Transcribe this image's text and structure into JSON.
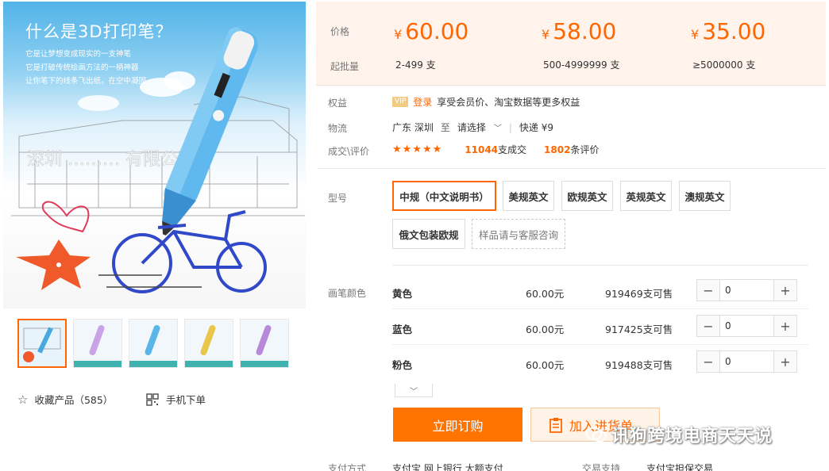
{
  "gallery": {
    "promo_title": "什么是3D打印笔？",
    "promo_lines": [
      "它是让梦想变成现实的一支神笔",
      "它是打破传统绘画方法的一柄神器",
      "让你笔下的线条飞出纸，在空中凝固"
    ],
    "watermark_text": "深圳…………有限公司",
    "thumbnail_colors": [
      "#4aa8e0",
      "#c9a3e6",
      "#5ab5e8",
      "#e8c64a",
      "#b78ad9"
    ],
    "favorite_label": "收藏产品（585）",
    "mobile_order_label": "手机下单"
  },
  "pricing": {
    "price_label": "价格",
    "moq_label": "起批量",
    "currency": "¥",
    "tiers": [
      {
        "price": "60.00",
        "range": "2-499 支"
      },
      {
        "price": "58.00",
        "range": "500-4999999 支"
      },
      {
        "price": "35.00",
        "range": "≥5000000 支"
      }
    ]
  },
  "benefits": {
    "label": "权益",
    "vip_badge": "VIP",
    "login_link": "登录",
    "text": "享受会员价、淘宝数据等更多权益"
  },
  "logistics": {
    "label": "物流",
    "origin": "广东 深圳",
    "to": "至",
    "destination": "请选择",
    "shipping": "快递 ¥9"
  },
  "reviews": {
    "label": "成交\\评价",
    "stars": "★★★★★",
    "deals_count": "11044",
    "deals_suffix": "支成交",
    "review_count": "1802",
    "review_suffix": "条评价"
  },
  "model": {
    "label": "型号",
    "options": [
      "中规（中文说明书）",
      "美规英文",
      "欧规英文",
      "英规英文",
      "澳规英文",
      "俄文包装欧规",
      "样品请与客服咨询"
    ],
    "selected": "中规（中文说明书）"
  },
  "pen_color": {
    "label": "画笔颜色",
    "rows": [
      {
        "name": "黄色",
        "price": "60.00元",
        "stock": "919469支可售",
        "qty": "0"
      },
      {
        "name": "蓝色",
        "price": "60.00元",
        "stock": "917425支可售",
        "qty": "0"
      },
      {
        "name": "粉色",
        "price": "60.00元",
        "stock": "919488支可售",
        "qty": "0"
      }
    ],
    "minus": "−",
    "plus": "+"
  },
  "actions": {
    "order_label": "立即订购",
    "cart_label": "加入进货单"
  },
  "watermark": "讯狗跨境电商天天说",
  "bottom": {
    "payment_label": "支付方式",
    "payment_value": "支付宝 网上银行 大额支付",
    "trade_label": "交易支持",
    "trade_value": "支付宝担保交易"
  }
}
